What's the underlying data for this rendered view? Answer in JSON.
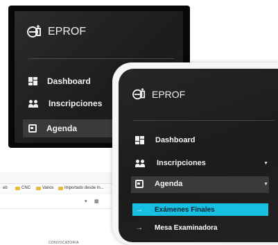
{
  "browser": {
    "bookmarks": [
      "eb",
      "CNC",
      "Varios",
      "Importado desde In..."
    ],
    "convocatoria_label": "CONVOCATORIA"
  },
  "sidebar_back": {
    "brand": "EPROF",
    "items": [
      {
        "label": "Dashboard",
        "icon": "dashboard-icon"
      },
      {
        "label": "Inscripciones",
        "icon": "users-icon"
      },
      {
        "label": "Agenda",
        "icon": "calendar-icon"
      }
    ]
  },
  "sidebar_front": {
    "brand": "EPROF",
    "items": [
      {
        "label": "Dashboard",
        "icon": "dashboard-icon"
      },
      {
        "label": "Inscripciones",
        "icon": "users-icon"
      },
      {
        "label": "Agenda",
        "icon": "calendar-icon"
      }
    ],
    "subitems": [
      {
        "label": "Exámenes Finales",
        "active": true
      },
      {
        "label": "Mesa Examinadora",
        "active": false
      }
    ],
    "accent_color": "#17bfe0"
  }
}
